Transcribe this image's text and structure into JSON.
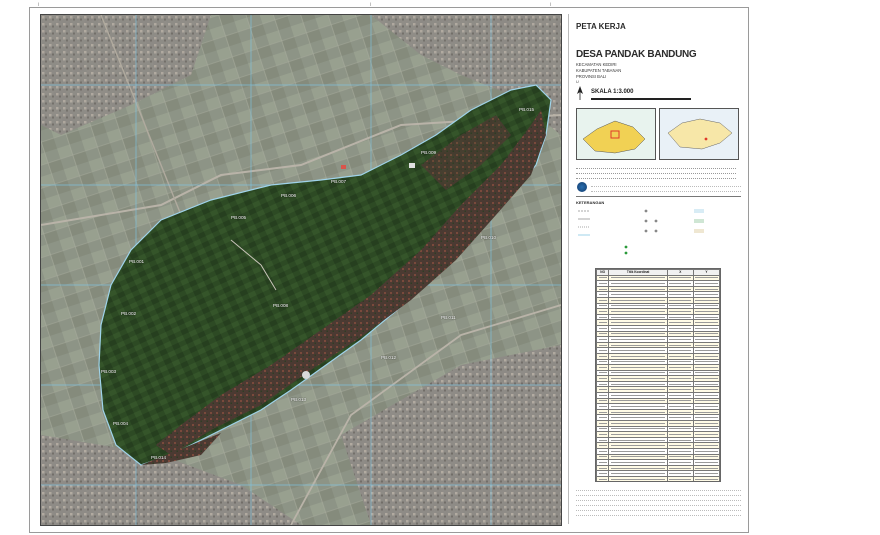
{
  "title": {
    "kind": "PETA KERJA",
    "village": "DESA PANDAK BANDUNG",
    "kecamatan": "KECAMATAN KEDIRI",
    "kabupaten": "KABUPATEN TABANAN",
    "provinsi": "PROVINSI BALI"
  },
  "scale": {
    "label": "SKALA 1:3.000"
  },
  "north": {
    "symbol": "U"
  },
  "legend": {
    "header": "KETERANGAN"
  },
  "map_labels": [
    "PB.001",
    "PB.002",
    "PB.003",
    "PB.004",
    "PB.005",
    "PB.006",
    "PB.007",
    "PB.008",
    "PB.009",
    "PB.010",
    "PB.011",
    "PB.012",
    "PB.013",
    "PB.014",
    "PB.015"
  ],
  "colors": {
    "boundary": "#9fd3ea",
    "vegetation": "#2f4a2a",
    "settlement": "#5a3a33",
    "ricefield": "#7c8a6a"
  },
  "coordinates_table": {
    "headers": [
      "NO",
      "Titik Koordinat",
      "X",
      "Y"
    ],
    "row_count": 42
  }
}
